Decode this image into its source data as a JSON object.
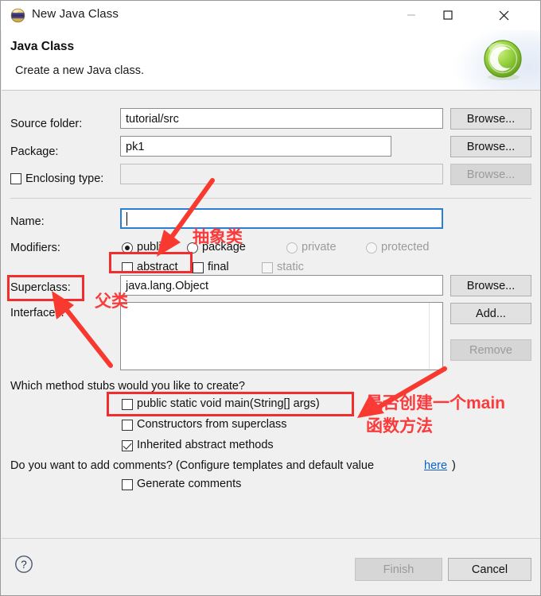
{
  "window": {
    "title": "New Java Class",
    "icon": "eclipse-sphere-icon",
    "controls": {
      "minimize": "minimize-icon",
      "maximize": "maximize-icon",
      "close": "close-icon"
    }
  },
  "header": {
    "title": "Java Class",
    "subtitle": "Create a new Java class.",
    "logo": "green-c-class-icon"
  },
  "form": {
    "source_folder": {
      "label": "Source folder:",
      "value": "tutorial/src",
      "browse_label": "Browse...",
      "browse_enabled": true
    },
    "package": {
      "label": "Package:",
      "value": "pk1",
      "browse_label": "Browse...",
      "browse_enabled": true
    },
    "enclosing_type": {
      "label": "Enclosing type:",
      "checked": false,
      "value": "",
      "browse_label": "Browse...",
      "browse_enabled": false
    },
    "name": {
      "label": "Name:",
      "value": "",
      "focused": true
    },
    "modifiers": {
      "label": "Modifiers:",
      "access": [
        {
          "label": "public",
          "selected": true,
          "enabled": true
        },
        {
          "label": "package",
          "selected": false,
          "enabled": true
        },
        {
          "label": "private",
          "selected": false,
          "enabled": false
        },
        {
          "label": "protected",
          "selected": false,
          "enabled": false
        }
      ],
      "flags": [
        {
          "label": "abstract",
          "checked": false,
          "enabled": true
        },
        {
          "label": "final",
          "checked": false,
          "enabled": true
        },
        {
          "label": "static",
          "checked": false,
          "enabled": false
        }
      ]
    },
    "superclass": {
      "label": "Superclass:",
      "value": "java.lang.Object",
      "browse_label": "Browse...",
      "browse_enabled": true
    },
    "interfaces": {
      "label": "Interfaces:",
      "items": [],
      "add_label": "Add...",
      "add_enabled": true,
      "remove_label": "Remove",
      "remove_enabled": false
    },
    "stubs": {
      "question": "Which method stubs would you like to create?",
      "options": [
        {
          "label": "public static void main(String[] args)",
          "checked": false
        },
        {
          "label": "Constructors from superclass",
          "checked": false
        },
        {
          "label": "Inherited abstract methods",
          "checked": true
        }
      ]
    },
    "comments": {
      "question_prefix": "Do you want to add comments? (Configure templates and default value ",
      "link_label": "here",
      "question_suffix": ")",
      "option": {
        "label": "Generate comments",
        "checked": false
      }
    }
  },
  "footer": {
    "help_icon": "help-question-icon",
    "finish_label": "Finish",
    "finish_enabled": false,
    "cancel_label": "Cancel",
    "cancel_enabled": true
  },
  "annotations": {
    "color": "#fb3b3b",
    "notes": [
      {
        "text": "抽象类",
        "meaning": "abstract-class-note"
      },
      {
        "text": "父类",
        "meaning": "superclass-note"
      },
      {
        "text_line1": "是否创建一个main",
        "text_line2": "函数方法",
        "meaning": "main-method-note"
      }
    ]
  }
}
